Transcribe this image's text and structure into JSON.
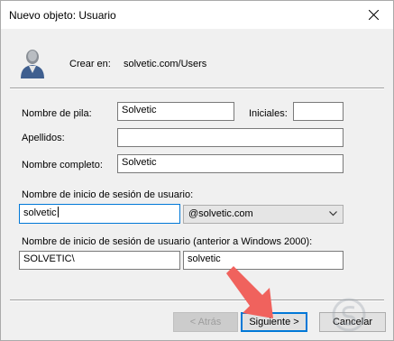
{
  "window": {
    "title": "Nuevo objeto: Usuario",
    "close_icon": "close-icon"
  },
  "header": {
    "create_in_label": "Crear en:",
    "create_in_value": "solvetic.com/Users"
  },
  "form": {
    "first_name_label": "Nombre de pila:",
    "first_name_value": "Solvetic",
    "initials_label": "Iniciales:",
    "initials_value": "",
    "last_name_label": "Apellidos:",
    "last_name_value": "",
    "full_name_label": "Nombre completo:",
    "full_name_value": "Solvetic",
    "logon_label": "Nombre de inicio de sesión de usuario:",
    "logon_value": "solvetic",
    "domain_value": "@solvetic.com",
    "pre2000_label": "Nombre de inicio de sesión de usuario (anterior a Windows 2000):",
    "pre2000_domain_value": "SOLVETIC\\",
    "pre2000_user_value": "solvetic"
  },
  "buttons": {
    "back": "< Atrás",
    "next": "Siguiente >",
    "cancel": "Cancelar"
  },
  "colors": {
    "focus": "#0078d7",
    "arrow": "#f0625d"
  }
}
